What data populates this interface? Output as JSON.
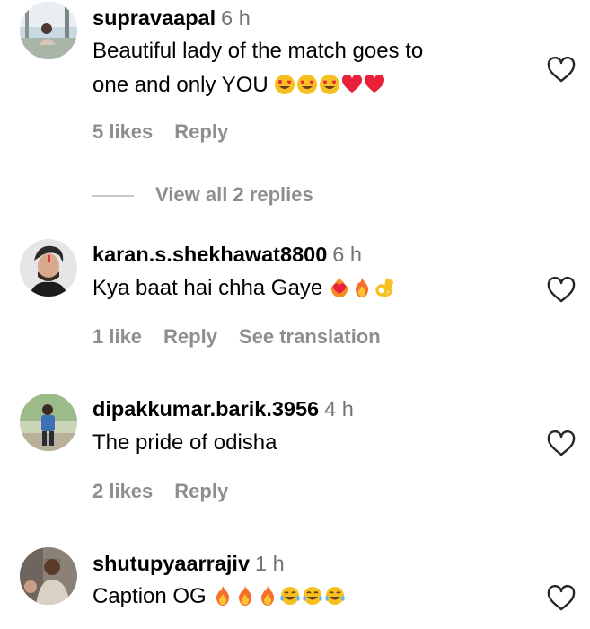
{
  "comments": [
    {
      "username": "supravaapal",
      "time": "6 h",
      "text_line1": "Beautiful lady of the match goes to",
      "text_line2": "one and only YOU",
      "emojis": [
        "heart-eyes-emoji",
        "heart-eyes-emoji",
        "heart-eyes-emoji",
        "red-heart-emoji",
        "red-heart-emoji"
      ],
      "likes": "5 likes",
      "reply": "Reply",
      "view_replies": "View all 2 replies"
    },
    {
      "username": "karan.s.shekhawat8800",
      "time": "6 h",
      "text": "Kya baat hai chha Gaye",
      "emojis": [
        "heart-on-fire-emoji",
        "fire-emoji",
        "ok-hand-emoji"
      ],
      "likes": "1 like",
      "reply": "Reply",
      "translate": "See translation"
    },
    {
      "username": "dipakkumar.barik.3956",
      "time": "4 h",
      "text": "The pride of odisha",
      "likes": "2 likes",
      "reply": "Reply"
    },
    {
      "username": "shutupyaarrajiv",
      "time": "1 h",
      "text": "Caption OG",
      "emojis": [
        "fire-emoji",
        "fire-emoji",
        "fire-emoji",
        "tears-of-joy-emoji",
        "tears-of-joy-emoji",
        "tears-of-joy-emoji"
      ]
    }
  ],
  "icons": {
    "like": "heart-outline-icon"
  },
  "colors": {
    "text": "#000000",
    "secondary": "#737373",
    "action": "#8e8e8e",
    "divider": "#c7c7c7"
  }
}
